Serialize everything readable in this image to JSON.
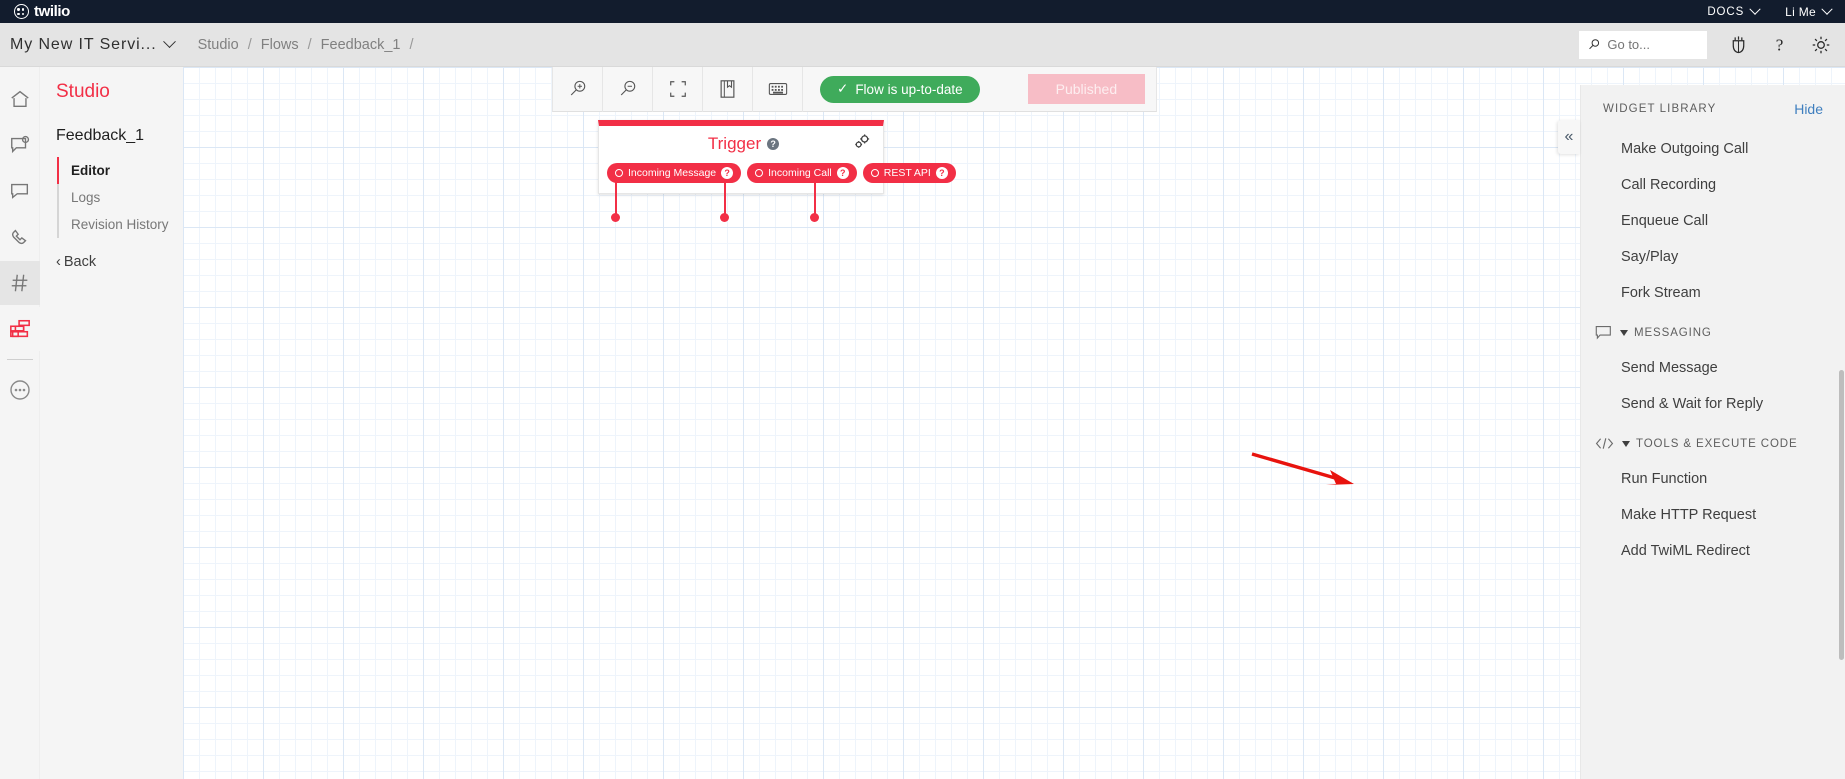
{
  "topbar": {
    "brand": "twilio",
    "docs_label": "DOCS",
    "user_label": "Li Me"
  },
  "breadcrumb": {
    "account": "My New IT Servi...",
    "path": [
      "Studio",
      "Flows",
      "Feedback_1"
    ],
    "separator": "/",
    "trailing_separator": "/"
  },
  "search": {
    "placeholder": "Go to...",
    "value": ""
  },
  "header_icons": {
    "bug": "bug-icon",
    "help": "help-icon",
    "settings": "gear-icon"
  },
  "rail": {
    "items": [
      {
        "name": "home-icon",
        "label": "Home"
      },
      {
        "name": "messaging-icon",
        "label": "Messaging"
      },
      {
        "name": "chat-icon",
        "label": "Chat"
      },
      {
        "name": "voice-icon",
        "label": "Voice"
      },
      {
        "name": "numbers-icon",
        "label": "Phone Numbers"
      },
      {
        "name": "studio-icon",
        "label": "Studio"
      },
      {
        "name": "more-icon",
        "label": "More"
      }
    ]
  },
  "sidebar": {
    "title": "Studio",
    "flow_name": "Feedback_1",
    "links": [
      {
        "label": "Editor",
        "active": true
      },
      {
        "label": "Logs",
        "active": false
      },
      {
        "label": "Revision History",
        "active": false
      }
    ],
    "back_label": "Back",
    "back_chevron": "‹"
  },
  "toolbar": {
    "zoom_in": "zoom-in-icon",
    "zoom_out": "zoom-out-icon",
    "fit_screen": "fit-to-screen-icon",
    "library": "library-icon",
    "keyboard": "keyboard-shortcuts-icon",
    "status_label": "Flow is up-to-date",
    "status_check": "✓",
    "status_color": "#3fab5b",
    "publish_label": "Published",
    "publish_color": "#f7bdc6"
  },
  "trigger": {
    "title": "Trigger",
    "help": "?",
    "settings_icon": "gear-icon",
    "accent_color": "#f22f46",
    "pills": [
      {
        "label": "Incoming Message",
        "help": "?"
      },
      {
        "label": "Incoming Call",
        "help": "?"
      },
      {
        "label": "REST API",
        "help": "?"
      }
    ]
  },
  "widget_library": {
    "header": "WIDGET LIBRARY",
    "hide_label": "Hide",
    "hide_color": "#3f7fbf",
    "collapse_icon": "«",
    "groups": [
      {
        "section": null,
        "icon": null,
        "items": [
          "Make Outgoing Call",
          "Call Recording",
          "Enqueue Call",
          "Say/Play",
          "Fork Stream"
        ]
      },
      {
        "section": "MESSAGING",
        "icon": "messaging-icon",
        "items": [
          "Send Message",
          "Send & Wait for Reply"
        ]
      },
      {
        "section": "TOOLS & EXECUTE CODE",
        "icon": "code-icon",
        "items": [
          "Run Function",
          "Make HTTP Request",
          "Add TwiML Redirect"
        ]
      }
    ]
  },
  "annotation": {
    "arrow_color": "#e8130e",
    "points_to": "Send & Wait for Reply"
  }
}
